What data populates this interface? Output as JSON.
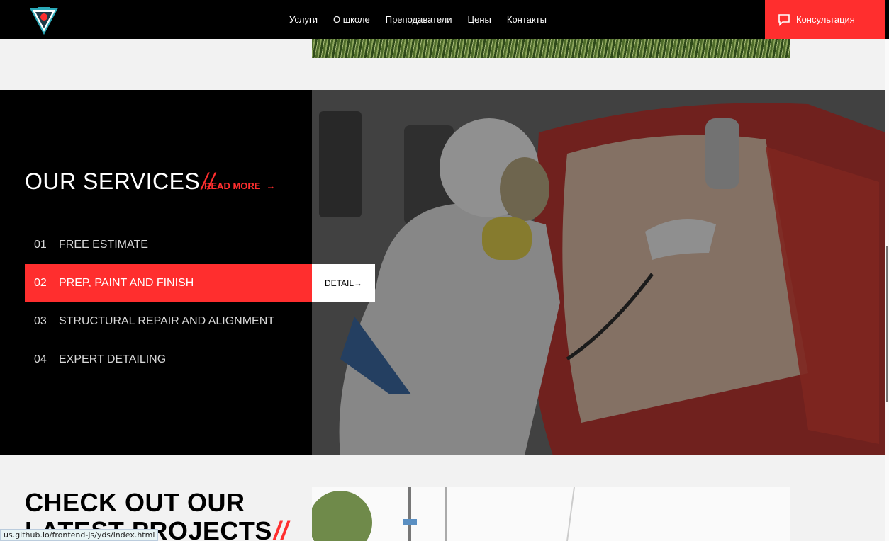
{
  "header": {
    "nav": [
      "Услуги",
      "О школе",
      "Преподаватели",
      "Цены",
      "Контакты"
    ],
    "consult_label": "Консультация"
  },
  "services": {
    "title": "OUR SERVICES",
    "title_suffix": "//",
    "read_more": "READ MORE",
    "read_more_arrow": "→",
    "items": [
      {
        "num": "01",
        "label": "FREE ESTIMATE"
      },
      {
        "num": "02",
        "label": "PREP, PAINT AND FINISH"
      },
      {
        "num": "03",
        "label": "STRUCTURAL REPAIR AND ALIGNMENT"
      },
      {
        "num": "04",
        "label": "EXPERT DETAILING"
      }
    ],
    "active_index": 1,
    "detail_label": "DETAIL→"
  },
  "projects": {
    "line1": "CHECK OUT OUR",
    "line2": "LATEST PROJECTS",
    "suffix": "//"
  },
  "status_bar": {
    "url": "us.github.io/frontend-js/yds/index.html"
  },
  "colors": {
    "accent": "#ff2e2e",
    "dark": "#000000",
    "light_bg": "#f2f2f2"
  }
}
